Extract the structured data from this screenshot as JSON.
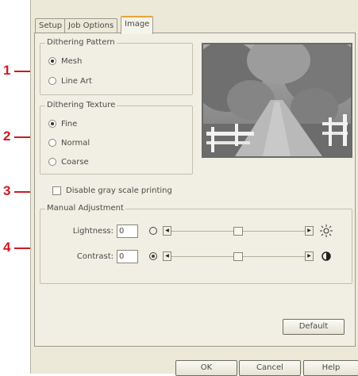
{
  "callouts": [
    "1",
    "2",
    "3",
    "4"
  ],
  "tabs": [
    {
      "label": "Setup"
    },
    {
      "label": "Job Options"
    },
    {
      "label": "Image"
    }
  ],
  "dithering_pattern": {
    "title": "Dithering Pattern",
    "options": [
      {
        "label": "Mesh",
        "selected": true
      },
      {
        "label": "Line Art",
        "selected": false
      }
    ]
  },
  "dithering_texture": {
    "title": "Dithering Texture",
    "options": [
      {
        "label": "Fine",
        "selected": true
      },
      {
        "label": "Normal",
        "selected": false
      },
      {
        "label": "Coarse",
        "selected": false
      }
    ]
  },
  "disable_gray": {
    "label": "Disable gray scale printing",
    "checked": false
  },
  "manual_adjustment": {
    "title": "Manual Adjustment",
    "lightness": {
      "label": "Lightness:",
      "value": "0",
      "level": 0.5
    },
    "contrast": {
      "label": "Contrast:",
      "value": "0",
      "level": 0.5
    }
  },
  "buttons": {
    "default": "Default",
    "ok": "OK",
    "cancel": "Cancel",
    "help": "Help"
  },
  "icons": {
    "preview": "landscape-preview-image",
    "brightness": "sun-icon",
    "contrast": "contrast-icon"
  }
}
